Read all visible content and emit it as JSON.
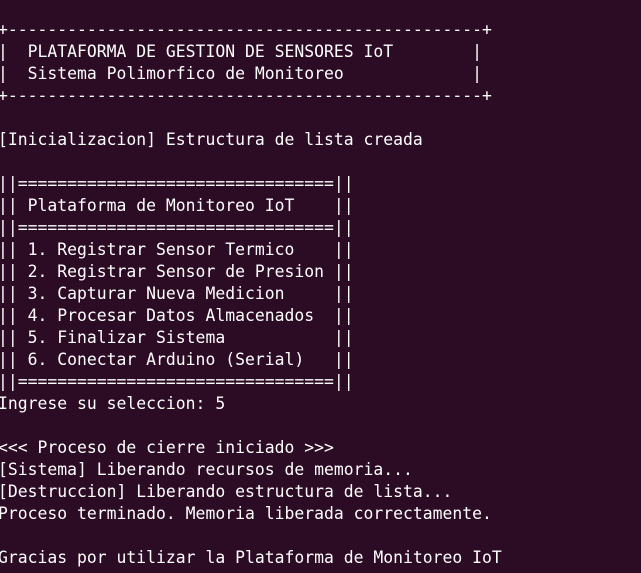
{
  "terminal": {
    "background": "#2c0b24",
    "foreground": "#ffffff",
    "lines": [
      "+------------------------------------------------+",
      "|  PLATAFORMA DE GESTION DE SENSORES IoT        |",
      "|  Sistema Polimorfico de Monitoreo             |",
      "+------------------------------------------------+",
      "",
      "[Inicializacion] Estructura de lista creada",
      "",
      "||================================||",
      "|| Plataforma de Monitoreo IoT    ||",
      "||================================||",
      "|| 1. Registrar Sensor Termico    ||",
      "|| 2. Registrar Sensor de Presion ||",
      "|| 3. Capturar Nueva Medicion     ||",
      "|| 4. Procesar Datos Almacenados  ||",
      "|| 5. Finalizar Sistema           ||",
      "|| 6. Conectar Arduino (Serial)   ||",
      "||================================||",
      "Ingrese su seleccion: 5",
      "",
      "<<< Proceso de cierre iniciado >>>",
      "[Sistema] Liberando recursos de memoria...",
      "[Destruccion] Liberando estructura de lista...",
      "Proceso terminado. Memoria liberada correctamente.",
      "",
      "Gracias por utilizar la Plataforma de Monitoreo IoT"
    ]
  }
}
